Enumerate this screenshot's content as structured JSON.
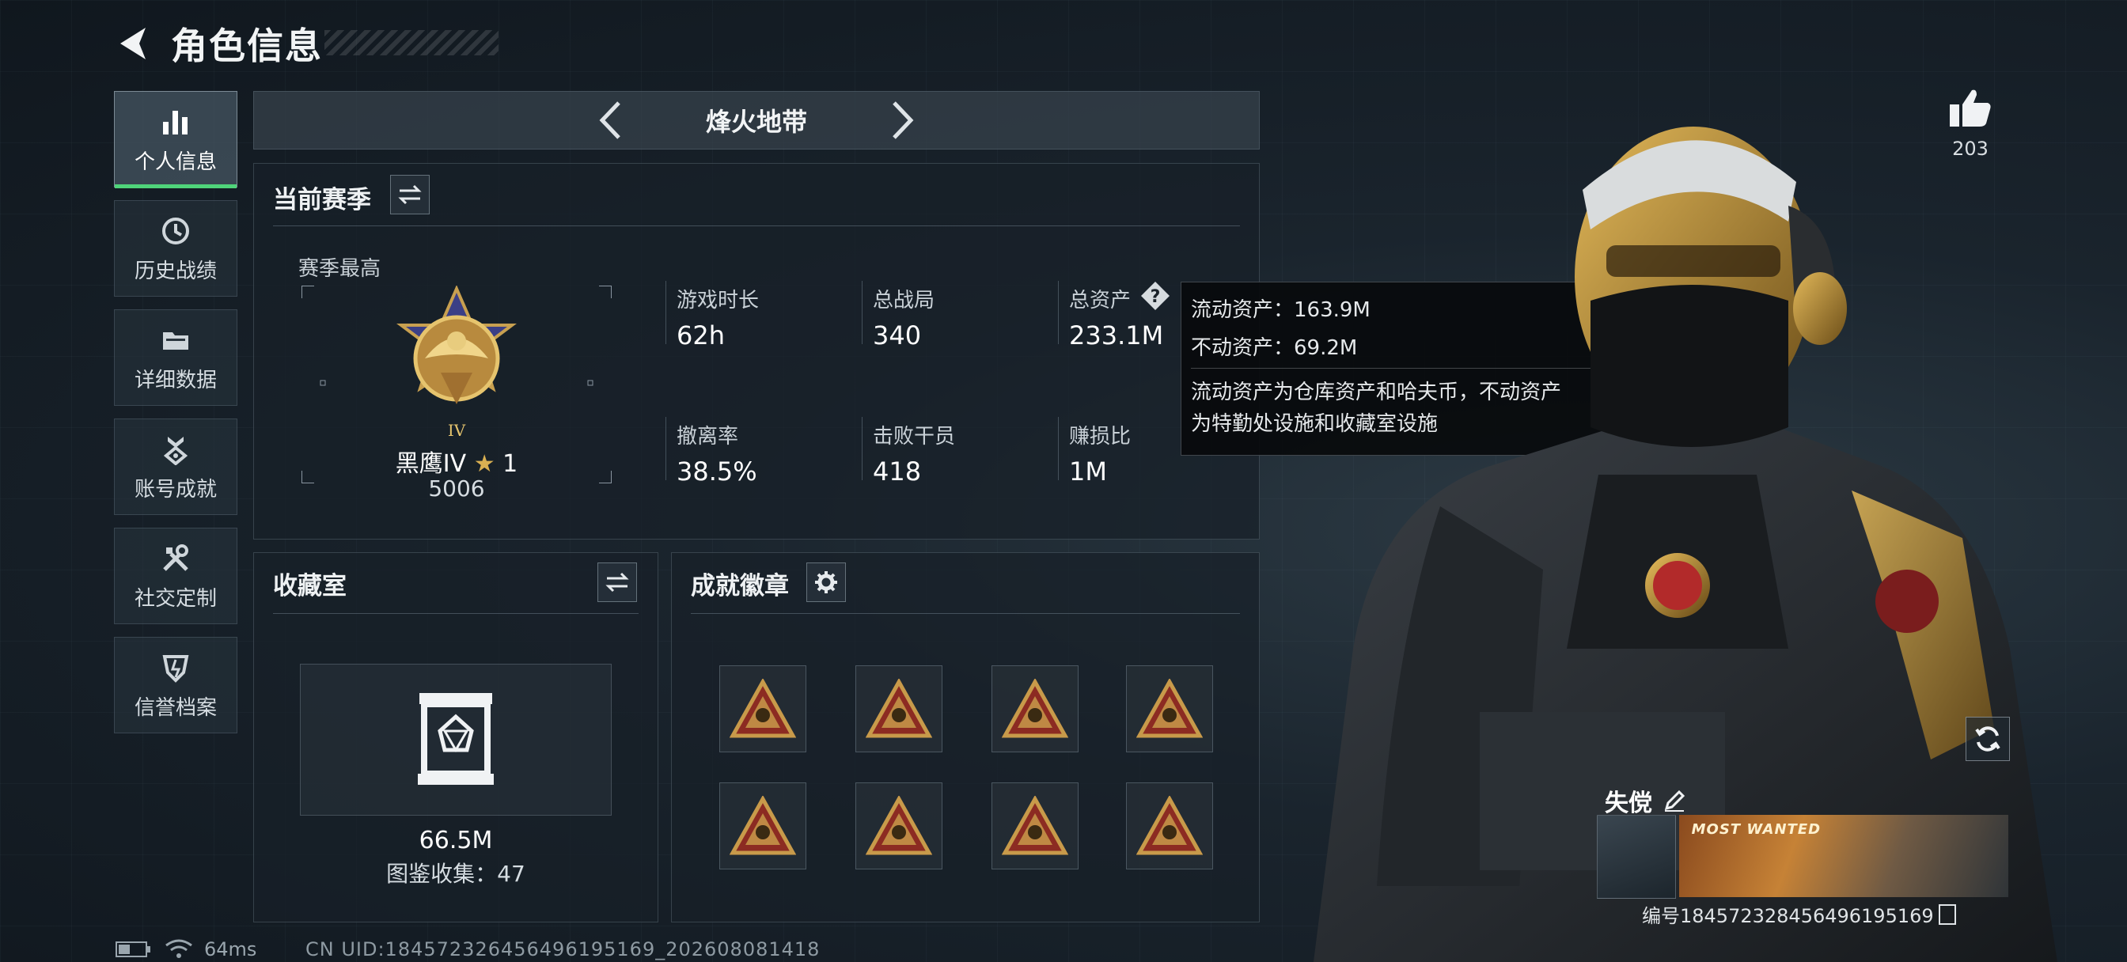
{
  "header": {
    "title": "角色信息"
  },
  "sidebar": {
    "items": [
      {
        "label": "个人信息",
        "icon": "bar-chart-icon",
        "active": true
      },
      {
        "label": "历史战绩",
        "icon": "history-icon"
      },
      {
        "label": "详细数据",
        "icon": "folder-icon"
      },
      {
        "label": "账号成就",
        "icon": "achievement-icon"
      },
      {
        "label": "社交定制",
        "icon": "tools-icon"
      },
      {
        "label": "信誉档案",
        "icon": "credit-icon"
      }
    ]
  },
  "map_selector": {
    "name": "烽火地带"
  },
  "current_season": {
    "title": "当前赛季",
    "season_best_label": "赛季最高",
    "rank_name": "黑鹰IV",
    "rank_stars": "1",
    "rank_score": "5006",
    "stats": [
      {
        "label": "游戏时长",
        "value": "62h"
      },
      {
        "label": "总战局",
        "value": "340"
      },
      {
        "label": "总资产",
        "value": "233.1M"
      },
      {
        "label": "撤离率",
        "value": "38.5%"
      },
      {
        "label": "击败干员",
        "value": "418"
      },
      {
        "label": "赚损比",
        "value": "1M"
      }
    ]
  },
  "tooltip": {
    "liquid": "流动资产：163.9M",
    "fixed": "不动资产：69.2M",
    "desc_line1": "流动资产为仓库资产和哈夫币，不动资产",
    "desc_line2": "为特勤处设施和收藏室设施"
  },
  "collection": {
    "title": "收藏室",
    "value": "66.5M",
    "count_text": "图鉴收集：47"
  },
  "achievements": {
    "title": "成就徽章",
    "badges": [
      "badge-54",
      "badge-bottle",
      "badge-55",
      "badge-eagle",
      "badge-56",
      "badge-57",
      "badge-58",
      "badge-59"
    ]
  },
  "profile": {
    "likes": "203",
    "nickname": "失傥",
    "banner_text": "MOST WANTED",
    "id_text": "编号1845723284564961951​69"
  },
  "status": {
    "ping": "64ms",
    "uid": "CN UID:184572326456496195169_202608081418"
  },
  "colors": {
    "active_accent": "#4fd47a",
    "badge_gold": "#c89a4a",
    "badge_red": "#8c2b22"
  }
}
